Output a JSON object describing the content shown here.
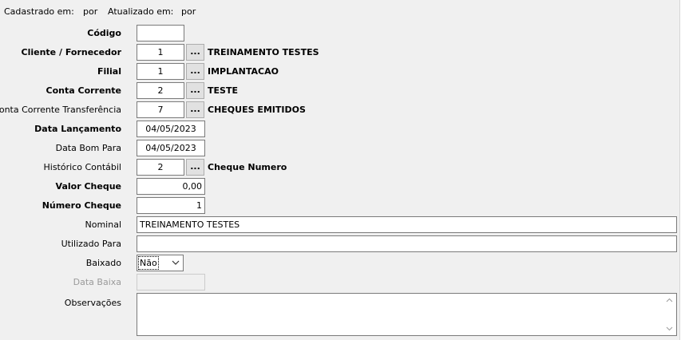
{
  "header": {
    "created_label": "Cadastrado em:",
    "created_by": "por",
    "updated_label": "Atualizado em:",
    "updated_by": "por"
  },
  "form": {
    "codigo": {
      "label": "Código",
      "value": ""
    },
    "cliente": {
      "label": "Cliente / Fornecedor",
      "value": "1",
      "lookup": "...",
      "desc": "TREINAMENTO TESTES"
    },
    "filial": {
      "label": "Filial",
      "value": "1",
      "lookup": "...",
      "desc": "IMPLANTACAO"
    },
    "conta_corrente": {
      "label": "Conta Corrente",
      "value": "2",
      "lookup": "...",
      "desc": "TESTE"
    },
    "conta_transferencia": {
      "label": "Conta Corrente Transferência",
      "value": "7",
      "lookup": "...",
      "desc": "CHEQUES EMITIDOS"
    },
    "data_lancamento": {
      "label": "Data Lançamento",
      "value": "04/05/2023"
    },
    "data_bom_para": {
      "label": "Data Bom Para",
      "value": "04/05/2023"
    },
    "historico": {
      "label": "Histórico Contábil",
      "value": "2",
      "lookup": "...",
      "desc": "Cheque Numero"
    },
    "valor_cheque": {
      "label": "Valor Cheque",
      "value": "0,00"
    },
    "numero_cheque": {
      "label": "Número Cheque",
      "value": "1"
    },
    "nominal": {
      "label": "Nominal",
      "value": "TREINAMENTO TESTES"
    },
    "utilizado_para": {
      "label": "Utilizado Para",
      "value": ""
    },
    "baixado": {
      "label": "Baixado",
      "value": "Não"
    },
    "data_baixa": {
      "label": "Data Baixa",
      "value": ""
    },
    "observacoes": {
      "label": "Observações",
      "value": ""
    }
  },
  "icons": {
    "dropdown": "chevron-down-icon",
    "scroll_up": "scroll-up-arrow-icon",
    "scroll_down": "scroll-down-arrow-icon"
  }
}
